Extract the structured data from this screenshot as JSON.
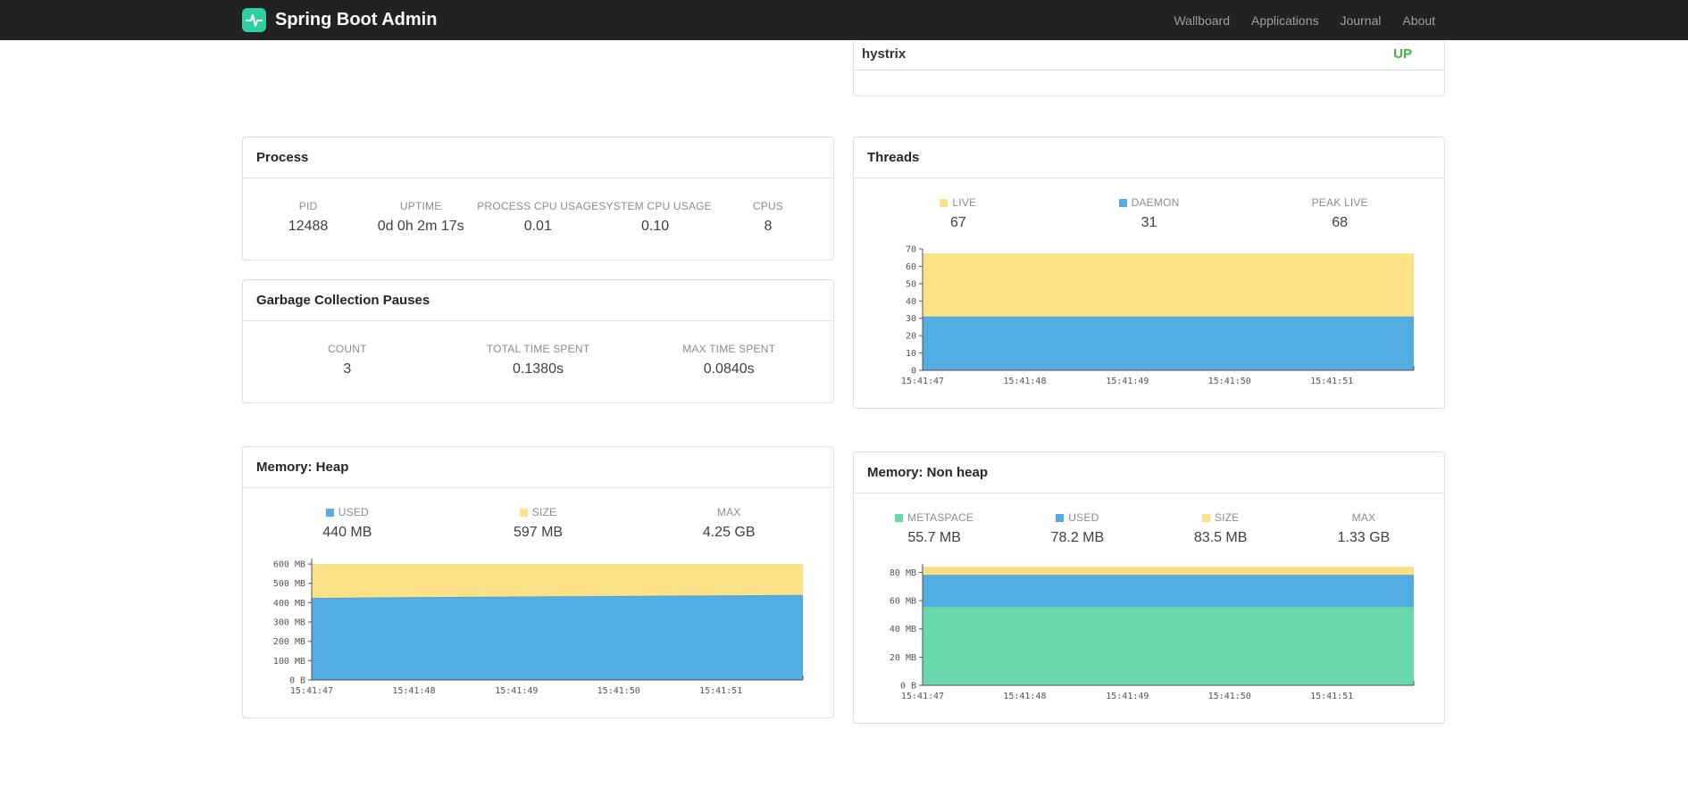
{
  "navbar": {
    "brand": "Spring Boot Admin",
    "links": [
      "Wallboard",
      "Applications",
      "Journal",
      "About"
    ]
  },
  "service_panel": {
    "name": "hystrix",
    "status": "UP",
    "status_color": "#43b343"
  },
  "panels": {
    "process": {
      "title": "Process",
      "metrics": [
        {
          "label": "PID",
          "value": "12488"
        },
        {
          "label": "UPTIME",
          "value": "0d 0h 2m 17s"
        },
        {
          "label": "PROCESS CPU USAGE",
          "value": "0.01"
        },
        {
          "label": "SYSTEM CPU USAGE",
          "value": "0.10"
        },
        {
          "label": "CPUS",
          "value": "8"
        }
      ]
    },
    "gc": {
      "title": "Garbage Collection Pauses",
      "metrics": [
        {
          "label": "COUNT",
          "value": "3"
        },
        {
          "label": "TOTAL TIME SPENT",
          "value": "0.1380s"
        },
        {
          "label": "MAX TIME SPENT",
          "value": "0.0840s"
        }
      ]
    },
    "threads": {
      "title": "Threads",
      "legend": [
        {
          "label": "LIVE",
          "value": "67",
          "swatch": "#fbe187"
        },
        {
          "label": "DAEMON",
          "value": "31",
          "swatch": "#54ade2"
        },
        {
          "label": "PEAK LIVE",
          "value": "68"
        }
      ]
    },
    "memory_heap": {
      "title": "Memory: Heap",
      "legend": [
        {
          "label": "USED",
          "value": "440 MB",
          "swatch": "#54ade2"
        },
        {
          "label": "SIZE",
          "value": "597 MB",
          "swatch": "#fbe187"
        },
        {
          "label": "MAX",
          "value": "4.25 GB"
        }
      ]
    },
    "memory_nonheap": {
      "title": "Memory: Non heap",
      "legend": [
        {
          "label": "METASPACE",
          "value": "55.7 MB",
          "swatch": "#69d9ac"
        },
        {
          "label": "USED",
          "value": "78.2 MB",
          "swatch": "#54ade2"
        },
        {
          "label": "SIZE",
          "value": "83.5 MB",
          "swatch": "#fbe187"
        },
        {
          "label": "MAX",
          "value": "1.33 GB"
        }
      ]
    }
  },
  "chart_data": [
    {
      "id": "threads",
      "type": "area",
      "title": "Threads",
      "stacked_absolute_tops": true,
      "y_max": 70,
      "y_ticks": [
        {
          "v": 0,
          "label": "0"
        },
        {
          "v": 10,
          "label": "10"
        },
        {
          "v": 20,
          "label": "20"
        },
        {
          "v": 30,
          "label": "30"
        },
        {
          "v": 40,
          "label": "40"
        },
        {
          "v": 50,
          "label": "50"
        },
        {
          "v": 60,
          "label": "60"
        },
        {
          "v": 70,
          "label": "70"
        }
      ],
      "x_labels": [
        "15:41:47",
        "15:41:48",
        "15:41:49",
        "15:41:50",
        "15:41:51"
      ],
      "x_fracs": [
        0,
        0.208,
        0.417,
        0.625,
        0.833
      ],
      "series": [
        {
          "name": "DAEMON",
          "fill": "#54ade2",
          "line": "#2f96d8",
          "values": [
            31,
            31,
            31,
            31,
            31,
            31
          ]
        },
        {
          "name": "LIVE",
          "fill": "#fbe187",
          "line": "#f6d35e",
          "values": [
            67,
            67,
            67,
            67,
            67,
            67
          ]
        }
      ]
    },
    {
      "id": "memory-heap",
      "type": "area",
      "title": "Memory: Heap",
      "stacked_absolute_tops": true,
      "y_max": 628,
      "y_ticks": [
        {
          "v": 0,
          "label": "0 B"
        },
        {
          "v": 100,
          "label": "100 MB"
        },
        {
          "v": 200,
          "label": "200 MB"
        },
        {
          "v": 300,
          "label": "300 MB"
        },
        {
          "v": 400,
          "label": "400 MB"
        },
        {
          "v": 500,
          "label": "500 MB"
        },
        {
          "v": 600,
          "label": "600 MB"
        }
      ],
      "x_labels": [
        "15:41:47",
        "15:41:48",
        "15:41:49",
        "15:41:50",
        "15:41:51"
      ],
      "x_fracs": [
        0,
        0.208,
        0.417,
        0.625,
        0.833
      ],
      "series": [
        {
          "name": "USED",
          "fill": "#54ade2",
          "line": "#2f96d8",
          "values": [
            424,
            428,
            431,
            434,
            437,
            440
          ]
        },
        {
          "name": "SIZE",
          "fill": "#fbe187",
          "line": "#f6d35e",
          "values": [
            597,
            597,
            597,
            597,
            597,
            597
          ]
        }
      ]
    },
    {
      "id": "memory-nonheap",
      "type": "area",
      "title": "Memory: Non heap",
      "stacked_absolute_tops": true,
      "y_max": 86,
      "y_ticks": [
        {
          "v": 0,
          "label": "0 B"
        },
        {
          "v": 20,
          "label": "20 MB"
        },
        {
          "v": 40,
          "label": "40 MB"
        },
        {
          "v": 60,
          "label": "60 MB"
        },
        {
          "v": 80,
          "label": "80 MB"
        }
      ],
      "x_labels": [
        "15:41:47",
        "15:41:48",
        "15:41:49",
        "15:41:50",
        "15:41:51"
      ],
      "x_fracs": [
        0,
        0.208,
        0.417,
        0.625,
        0.833
      ],
      "series": [
        {
          "name": "METASPACE",
          "fill": "#69d9ac",
          "line": "#3fcb92",
          "values": [
            55.7,
            55.7,
            55.7,
            55.7,
            55.7,
            55.7
          ]
        },
        {
          "name": "USED",
          "fill": "#54ade2",
          "line": "#2f96d8",
          "values": [
            78.2,
            78.2,
            78.2,
            78.2,
            78.2,
            78.2
          ]
        },
        {
          "name": "SIZE",
          "fill": "#fbe187",
          "line": "#f6d35e",
          "values": [
            83.5,
            83.5,
            83.5,
            83.5,
            83.5,
            83.5
          ]
        }
      ]
    }
  ]
}
